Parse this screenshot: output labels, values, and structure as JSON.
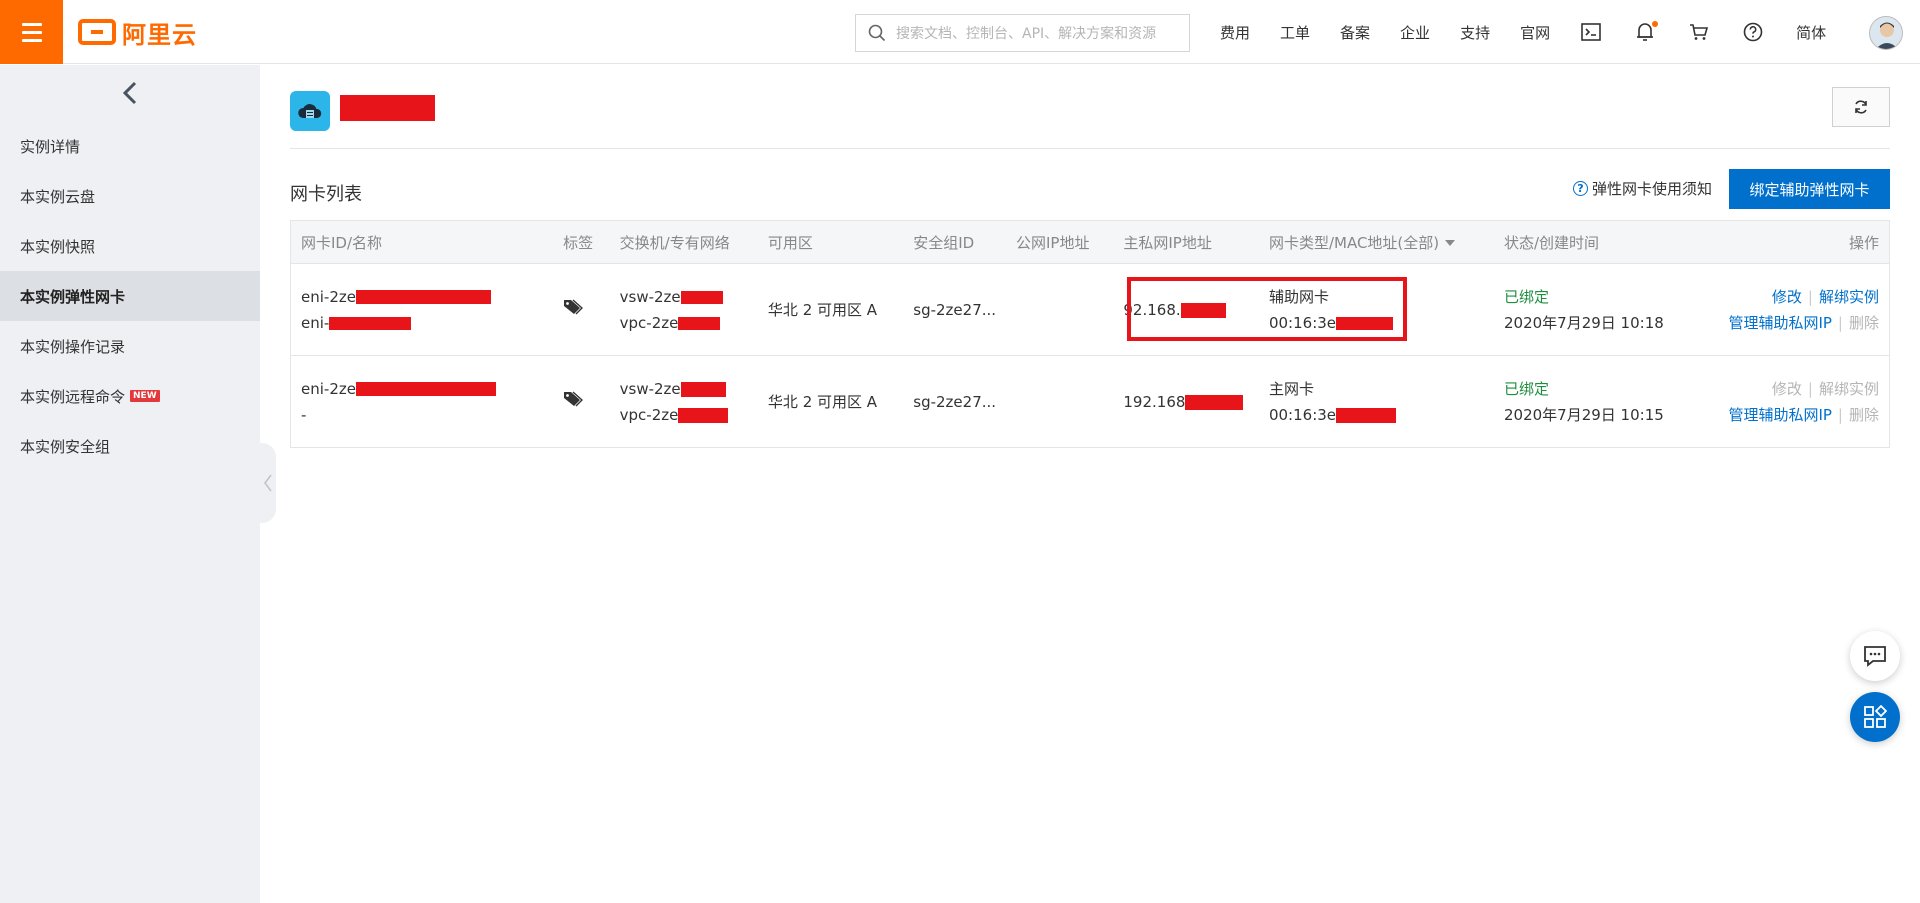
{
  "brand": {
    "logo_text": "阿里云",
    "accent": "#ff6a00",
    "primary": "#0070cc"
  },
  "search": {
    "placeholder": "搜索文档、控制台、API、解决方案和资源"
  },
  "nav": {
    "items": [
      "费用",
      "工单",
      "备案",
      "企业",
      "支持",
      "官网"
    ],
    "icons": [
      "terminal-icon",
      "bell-icon",
      "cart-icon",
      "help-icon"
    ],
    "lang": "简体"
  },
  "sidebar": {
    "items": [
      {
        "label": "实例详情"
      },
      {
        "label": "本实例云盘"
      },
      {
        "label": "本实例快照"
      },
      {
        "label": "本实例弹性网卡",
        "active": true
      },
      {
        "label": "本实例操作记录"
      },
      {
        "label": "本实例远程命令",
        "badge": "NEW"
      },
      {
        "label": "本实例安全组"
      }
    ]
  },
  "section": {
    "title": "网卡列表",
    "help_text": "弹性网卡使用须知",
    "bind_button": "绑定辅助弹性网卡"
  },
  "table": {
    "headers": [
      "网卡ID/名称",
      "标签",
      "交换机/专有网络",
      "可用区",
      "安全组ID",
      "公网IP地址",
      "主私网IP地址",
      "网卡类型/MAC地址(全部)",
      "状态/创建时间",
      "操作"
    ],
    "rows": [
      {
        "id": "eni-2ze",
        "name": "eni-",
        "vsw": "vsw-2ze",
        "vpc": "vpc-2ze",
        "zone": "华北 2 可用区 A",
        "sg": "sg-2ze27...",
        "public_ip": "",
        "private_ip": "92.168.",
        "type": "辅助网卡",
        "mac": "00:16:3e",
        "status": "已绑定",
        "created": "2020年7月29日 10:18",
        "op_edit": "修改",
        "op_unbind": "解绑实例",
        "op_manage": "管理辅助私网IP",
        "op_delete": "删除",
        "edit_enabled": true
      },
      {
        "id": "eni-2ze",
        "name": "-",
        "vsw": "vsw-2ze",
        "vpc": "vpc-2ze",
        "zone": "华北 2 可用区 A",
        "sg": "sg-2ze27...",
        "public_ip": "",
        "private_ip": "192.168",
        "type": "主网卡",
        "mac": "00:16:3e",
        "status": "已绑定",
        "created": "2020年7月29日 10:15",
        "op_edit": "修改",
        "op_unbind": "解绑实例",
        "op_manage": "管理辅助私网IP",
        "op_delete": "删除",
        "edit_enabled": false
      }
    ]
  },
  "sep": "|"
}
